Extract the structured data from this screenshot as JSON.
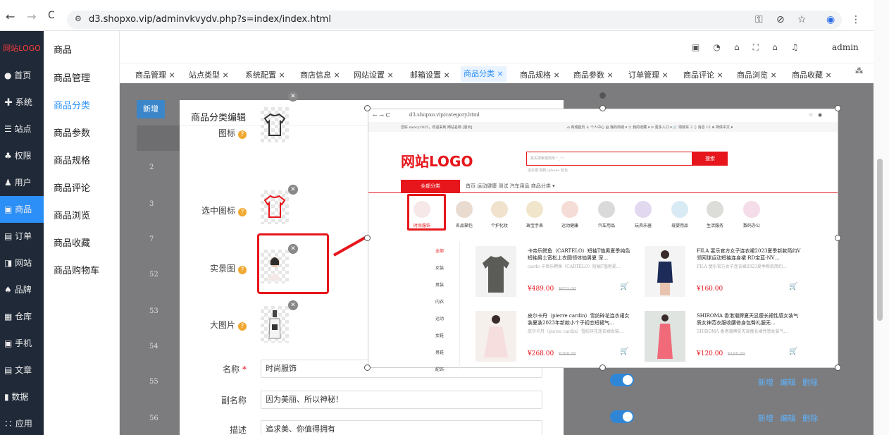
{
  "browser": {
    "url": "d3.shopxo.vip/adminvkvydv.php?s=index/index.html",
    "back": "←",
    "forward": "→",
    "reload": "C"
  },
  "sidebar": {
    "logo": "网站LOGO",
    "items": [
      "首页",
      "系统",
      "站点",
      "权限",
      "用户",
      "商品",
      "订单",
      "网站",
      "品牌",
      "仓库",
      "手机",
      "文章",
      "数据",
      "应用"
    ]
  },
  "subnav": {
    "title": "商品",
    "items": [
      "商品管理",
      "商品分类",
      "商品参数",
      "商品规格",
      "商品评论",
      "商品浏览",
      "商品收藏",
      "商品购物车"
    ]
  },
  "header": {
    "user": "admin"
  },
  "tabs": [
    "商品管理 ×",
    "站点类型 ×",
    "系统配置 ×",
    "商店信息 ×",
    "网站设置 ×",
    "邮箱设置 ×",
    "商品分类 ×",
    "商品规格 ×",
    "商品参数 ×",
    "订单管理 ×",
    "商品评论 ×",
    "商品浏览 ×",
    "商品收藏 ×"
  ],
  "content": {
    "add_label": "新增",
    "ids": [
      "2",
      "3",
      "7",
      "52",
      "53",
      "54",
      "55",
      "56"
    ]
  },
  "dialog": {
    "title": "商品分类编辑",
    "icon_label": "图标",
    "selected_icon_label": "选中图标",
    "real_image_label": "实景图",
    "big_image_label": "大图片",
    "name_label": "名称",
    "name_value": "时尚服饰",
    "subname_label": "副名称",
    "subname_value": "因为美丽、所以神秘！",
    "desc_label": "描述",
    "desc_value": "追求美、你值得拥有"
  },
  "row_actions": "新增 编辑 删除",
  "preview": {
    "url": "d3.shopxo.vip/category.html",
    "welcome": "您好 nancy2025，欢迎来到 网站名称 [退出]",
    "top_links": "⌂ 商城首页  ♙ 个人中心  ▤ 我的商城 ▾  ☆ 我的收藏 ▾  ⊙ 更多入口 ▾  🛒 购物车 2  ♫ 消息 15  ⊕ 简体中文 ▾",
    "logo": "网站LOGO",
    "search_placeholder": "其实搜索很简单^_^!",
    "search_btn": "搜索",
    "hot": "连衣裙  鞋靴  iphone  包包",
    "nav_all": "全部分类",
    "nav": "首页  运动健康  测试  汽车用品  商品分类 ▾",
    "cats": [
      "时尚服饰",
      "名品箱包",
      "个护化妆",
      "珠宝手表",
      "运动健康",
      "汽车用品",
      "玩具乐器",
      "母婴用品",
      "生活服务",
      "数码办公"
    ],
    "subcats": [
      "全部",
      "女装",
      "男装",
      "内衣",
      "运动",
      "女鞋",
      "男鞋",
      "配饰"
    ],
    "products": [
      {
        "title": "卡帝乐鳄鱼（CARTELO）短袖T恤男夏季纯色短袖男士宽松上衣圆领体恤男夏 深…",
        "desc": "cardo 卡帝乐鳄鱼（CARTELO）短袖T恤男夏…",
        "price": "¥489.00",
        "orig": "¥671.00"
      },
      {
        "title": "FILA 斐乐官方女子连衣裙2023夏季新款简约V领网球运动短袖连身裙 RD宝蓝-NV…",
        "desc": "FILA 斐乐官方女子连衣裙2023夏季新款简约…",
        "price": "¥160.00",
        "orig": ""
      },
      {
        "title": "皮尔卡丹（pierre cardin）雪纺碎花连衣裙女装夏装2023年新款小个子初恋短裙气…",
        "desc": "皮尔卡丹（pierre cardin）雪纺碎花连衣裙女装…",
        "price": "¥268.00",
        "orig": "¥299.00"
      },
      {
        "title": "SHIROMA 香港潮牌夏天显瘦长裙性感女装气质女神范衣服收腰修身包臀礼服无…",
        "desc": "SHIROMA 香港潮牌夏天显瘦长裙性感女装气…",
        "price": "¥120.00",
        "orig": "¥180.00"
      }
    ]
  }
}
